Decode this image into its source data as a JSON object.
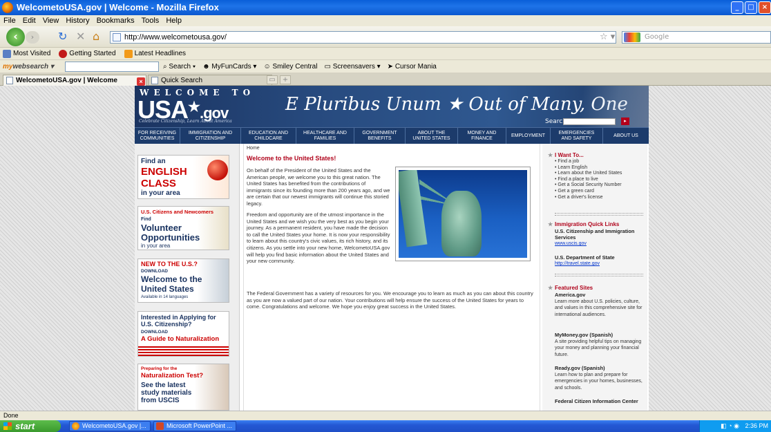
{
  "window": {
    "title": "WelcometoUSA.gov | Welcome - Mozilla Firefox"
  },
  "menu": [
    "File",
    "Edit",
    "View",
    "History",
    "Bookmarks",
    "Tools",
    "Help"
  ],
  "nav": {
    "url": "http://www.welcometousa.gov/",
    "search_placeholder": "Google"
  },
  "bookmarks": [
    "Most Visited",
    "Getting Started",
    "Latest Headlines"
  ],
  "search_toolbar": {
    "logo_a": "my",
    "logo_b": "websearch",
    "search_btn": "Search",
    "items": [
      "MyFunCards",
      "Smiley Central",
      "Screensavers",
      "Cursor Mania"
    ]
  },
  "tabs": [
    {
      "label": "WelcometoUSA.gov | Welcome",
      "active": true
    },
    {
      "label": "Quick Search",
      "active": false
    }
  ],
  "site": {
    "welcome_to": "WELCOME TO",
    "usa": "USA",
    "gov": ".gov",
    "tagline": "Celebrate Citizenship, Learn About America",
    "motto": "E Pluribus Unum ★ Out of Many, One",
    "search_label": "Search",
    "nav": [
      "FOR RECEIVING COMMUNITIES",
      "IMMIGRATION AND CITIZENSHIP",
      "EDUCATION AND CHILDCARE",
      "HEALTHCARE AND FAMILIES",
      "GOVERNMENT BENEFITS",
      "ABOUT THE UNITED STATES",
      "MONEY AND FINANCE",
      "EMPLOYMENT",
      "EMERGENCIES AND SAFETY",
      "ABOUT US"
    ],
    "promos": {
      "english": {
        "a": "Find an",
        "b": "ENGLISH",
        "c": "CLASS",
        "d": "in your area"
      },
      "volunteer": {
        "a": "U.S. Citizens and Newcomers",
        "b": "Find",
        "c": "Volunteer",
        "d": "Opportunities",
        "e": "in your area"
      },
      "newto": {
        "a": "NEW TO THE U.S.?",
        "b": "DOWNLOAD",
        "c": "Welcome to the",
        "d": "United States",
        "e": "Available in 14 languages"
      },
      "citizenship": {
        "a": "Interested in Applying for U.S. Citizenship?",
        "b": "DOWNLOAD",
        "c": "A Guide to Naturalization"
      },
      "test": {
        "a": "Preparing for the",
        "b": "Naturalization Test?",
        "c": "See the latest study materials from USCIS"
      }
    },
    "breadcrumb": "Home",
    "heading": "Welcome to the United States!",
    "para1": "On behalf of the President of the United States and the American people, we welcome you to this great nation. The United States has benefited from the contributions of immigrants since its founding more than 200 years ago, and we are certain that our newest immigrants will continue this storied legacy.",
    "para2": "Freedom and opportunity are of the utmost importance in the United States and we wish you the very best as you begin your journey. As a permanent resident, you have made the decision to call the United States your home. It is now your responsibility to learn about this country's civic values, its rich history, and its citizens. As you settle into your new home, WelcometoUSA.gov will help you find basic information about the United States and your new community.",
    "para3": "The Federal Government has a variety of resources for you. We encourage you to learn as much as you can about this country as you are now a valued part of our nation. Your contributions will help ensure the success of the United States for years to come. Congratulations and welcome. We hope you enjoy great success in the United States.",
    "right": {
      "iwant_title": "I Want To...",
      "iwant": [
        "• Find a job",
        "• Learn English",
        "• Learn about the United States",
        "• Find a place to live",
        "• Get a Social Security Number",
        "• Get a green card",
        "• Get a driver's license"
      ],
      "quick_title": "Immigration Quick Links",
      "uscis_name": "U.S. Citizenship and Immigration Services",
      "uscis_link": "www.uscis.gov",
      "state_name": "U.S. Department of State",
      "state_link": "http://travel.state.gov",
      "featured_title": "Featured Sites",
      "america_name": "America.gov",
      "america_desc": "Learn more about U.S. policies, culture, and values in this comprehensive site for international audiences.",
      "mymoney_name": "MyMoney.gov (Spanish)",
      "mymoney_desc": "A site providing helpful tips on managing your money and planning your financial future.",
      "ready_name": "Ready.gov (Spanish)",
      "ready_desc": "Learn how to plan and prepare for emergencies in your homes, businesses, and schools.",
      "fcic_name": "Federal Citizen Information Center"
    }
  },
  "status": "Done",
  "taskbar": {
    "start": "start",
    "items": [
      "WelcometoUSA.gov |...",
      "Microsoft PowerPoint ..."
    ],
    "time": "2:36 PM"
  }
}
